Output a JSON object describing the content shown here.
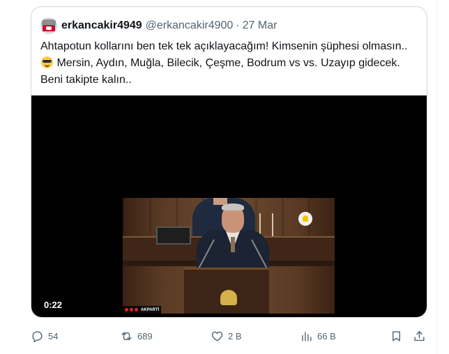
{
  "quoted_tweet": {
    "display_name": "erkancakir4949",
    "handle": "@erkancakir4900",
    "separator": "·",
    "date": "27 Mar",
    "text_part1": "Ahtapotun kollarını ben tek tek açıklayacağım! Kimsenin şüphesi olmasın..",
    "text_part2": " Mersin, Aydın, Muğla, Bilecik, Çeşme, Bodrum vs vs. Uzayıp gidecek. Beni takipte kalın..",
    "emoji_icon": "sunglasses-face-emoji",
    "video": {
      "duration": "0:22",
      "channel_logo": "AKPARTİ"
    }
  },
  "actions": {
    "reply": {
      "icon": "reply-icon",
      "count": "54"
    },
    "repost": {
      "icon": "repost-icon",
      "count": "689"
    },
    "like": {
      "icon": "like-icon",
      "count": "2 B"
    },
    "views": {
      "icon": "views-icon",
      "count": "66 B"
    },
    "bookmark": {
      "icon": "bookmark-icon"
    },
    "share": {
      "icon": "share-icon"
    }
  },
  "colors": {
    "text_primary": "#0f1419",
    "text_secondary": "#536471",
    "border": "#cfd9de"
  }
}
